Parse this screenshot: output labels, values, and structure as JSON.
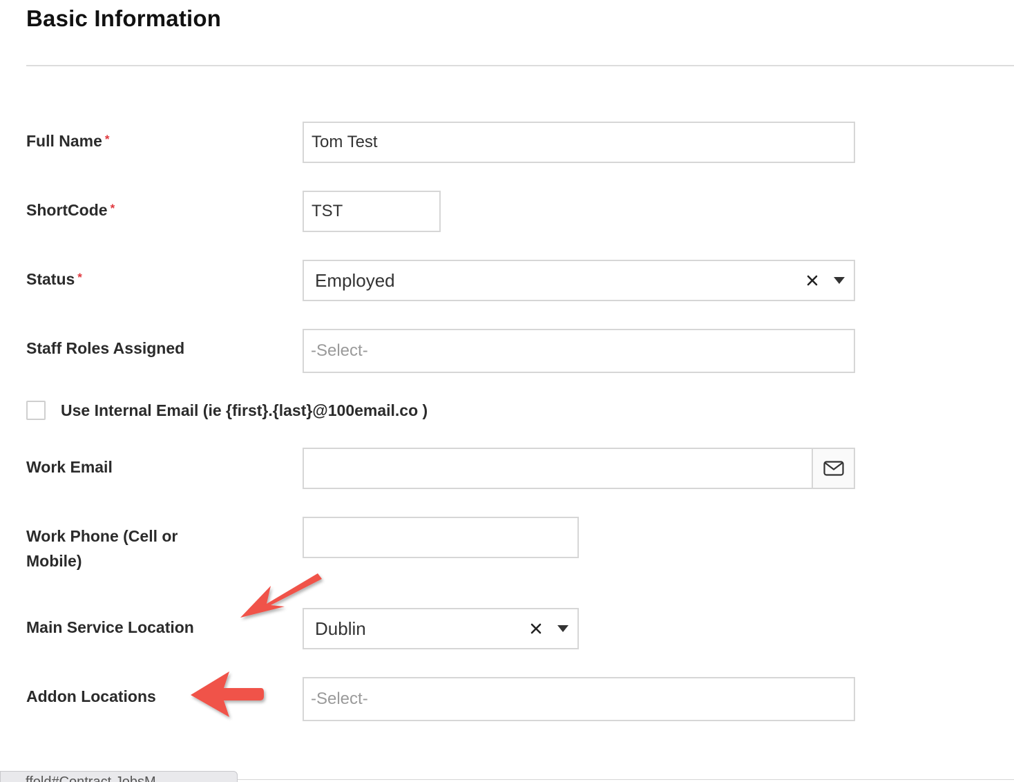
{
  "section": {
    "title": "Basic Information"
  },
  "form": {
    "full_name": {
      "label": "Full Name",
      "required_mark": "*",
      "value": "Tom Test"
    },
    "shortcode": {
      "label": "ShortCode",
      "required_mark": "*",
      "value": "TST"
    },
    "status": {
      "label": "Status",
      "required_mark": "*",
      "value": "Employed"
    },
    "staff_roles": {
      "label": "Staff Roles Assigned",
      "placeholder": "-Select-"
    },
    "internal_email": {
      "label": "Use Internal Email (ie {first}.{last}@100email.co )",
      "checked": false
    },
    "work_email": {
      "label": "Work Email",
      "value": "",
      "icon": "envelope-icon"
    },
    "work_phone": {
      "label_line1": "Work Phone (Cell or",
      "label_line2": "Mobile)",
      "value": ""
    },
    "main_location": {
      "label": "Main Service Location",
      "value": "Dublin"
    },
    "addon_locations": {
      "label": "Addon Locations",
      "placeholder": "-Select-"
    }
  },
  "annotations": {
    "arrow_color": "#f0524a"
  },
  "colors": {
    "required": "#e0383e",
    "border": "#d6d6d6",
    "placeholder": "#9a9a9a"
  },
  "footer": {
    "status_url_fragment": "ffold#Contract.JobsM"
  }
}
